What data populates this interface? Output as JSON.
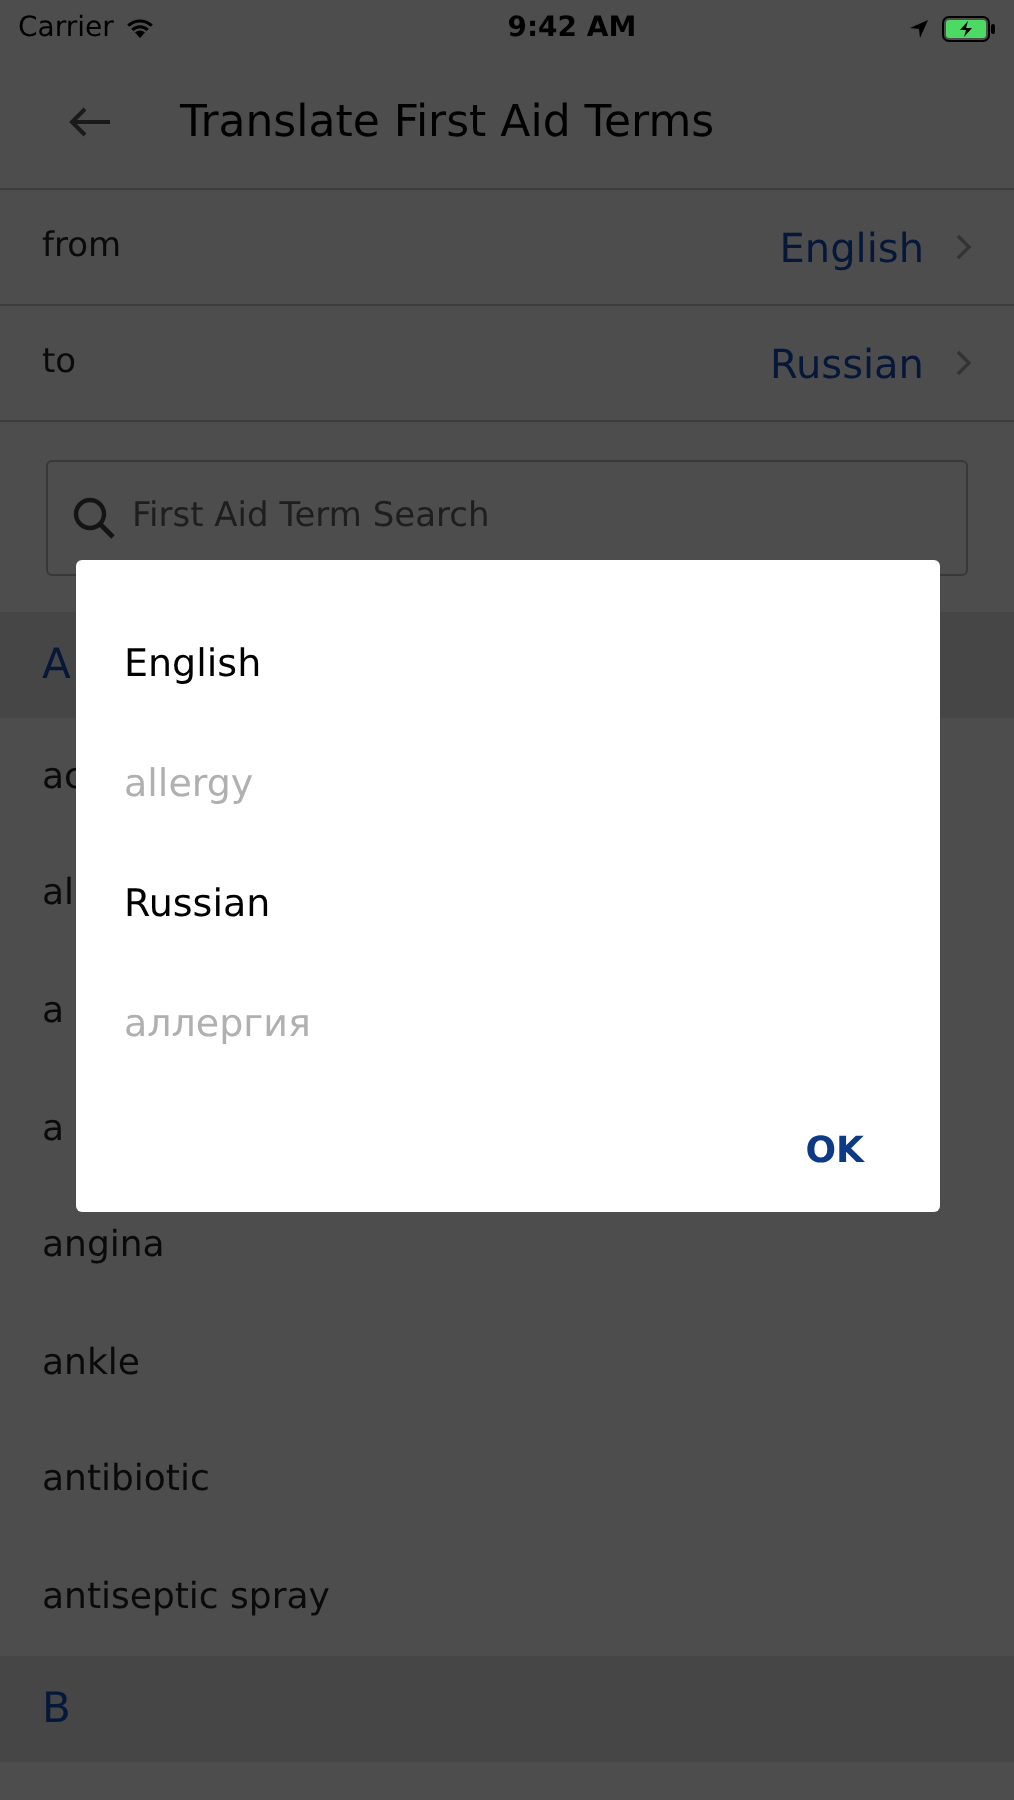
{
  "status_bar": {
    "carrier": "Carrier",
    "time": "9:42 AM"
  },
  "nav": {
    "title": "Translate First Aid Terms"
  },
  "language_rows": [
    {
      "label": "from",
      "value": "English"
    },
    {
      "label": "to",
      "value": "Russian"
    }
  ],
  "search": {
    "placeholder": "First Aid Term Search"
  },
  "sections": [
    {
      "header": "A",
      "terms": [
        "ac",
        "al",
        "a",
        "a",
        "angina",
        "ankle",
        "antibiotic",
        "antiseptic spray"
      ]
    },
    {
      "header": "B"
    }
  ],
  "dialog": {
    "lines": [
      {
        "kind": "language",
        "text": "English"
      },
      {
        "kind": "term",
        "text": "allergy"
      },
      {
        "kind": "language",
        "text": "Russian"
      },
      {
        "kind": "term",
        "text": "аллергия"
      }
    ],
    "button": "OK"
  }
}
